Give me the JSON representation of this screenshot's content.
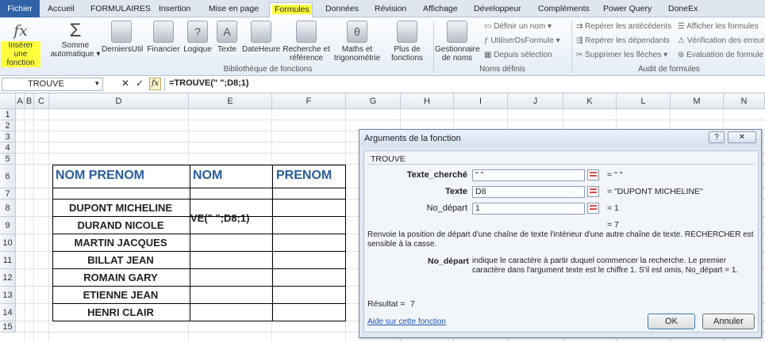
{
  "tabs": [
    "Fichier",
    "Accueil",
    "FORMULAIRES",
    "Insertion",
    "Mise en page",
    "Formules",
    "Données",
    "Révision",
    "Affichage",
    "Développeur",
    "Compléments",
    "Power Query",
    "DoneEx"
  ],
  "ribbon": {
    "insert_fn": "Insérer une fonction",
    "autosum": "Somme automatique",
    "lib_buttons": [
      "DerniersUtil",
      "Financier",
      "Logique",
      "Texte",
      "DateHeure",
      "Recherche et référence",
      "Maths et trigonométrie",
      "Plus de fonctions"
    ],
    "lib_icons": [
      "",
      "",
      "?",
      "A",
      "",
      "",
      "θ",
      ""
    ],
    "lib_group": "Bibliothèque de fonctions",
    "name_mgr": "Gestionnaire de noms",
    "define_name": "Définir un nom",
    "use_in_formula": "UtiliserDsFormule",
    "from_selection": "Depuis sélection",
    "names_group": "Noms définis",
    "trace_prec": "Repérer les antécédents",
    "trace_dep": "Repérer les dépendants",
    "remove_arrows": "Supprimer les flèches",
    "show_formulas": "Afficher les formules",
    "error_check": "Vérification des erreur",
    "eval_formula": "Évaluation de formule",
    "audit_group": "Audit de formules"
  },
  "formula_bar": {
    "name_box": "TROUVE",
    "fx": "fx",
    "formula": "=TROUVE(\" \";D8;1)"
  },
  "columns": [
    "A",
    "B",
    "C",
    "D",
    "E",
    "F",
    "G",
    "H",
    "I",
    "J",
    "K",
    "L",
    "M",
    "N"
  ],
  "rows": [
    "1",
    "2",
    "3",
    "4",
    "5",
    "6",
    "7",
    "8",
    "9",
    "10",
    "11",
    "12",
    "13",
    "14",
    "15"
  ],
  "table": {
    "headers": [
      "NOM PRENOM",
      "NOM",
      "PRENOM"
    ],
    "names": [
      "DUPONT  MICHELINE",
      "DURAND  NICOLE",
      "MARTIN JACQUES",
      "BILLAT JEAN",
      "ROMAIN GARY",
      "ETIENNE JEAN",
      "HENRI  CLAIR"
    ],
    "e8": "VE(\" \";D8;1)"
  },
  "dialog": {
    "title": "Arguments de la fonction",
    "help_btn": "?",
    "close_btn": "✕",
    "fn_name": "TROUVE",
    "args": [
      {
        "label": "Texte_cherché",
        "value": "\" \"",
        "result": "= \" \""
      },
      {
        "label": "Texte",
        "value": "D8",
        "result": "= \"DUPONT  MICHELINE\""
      },
      {
        "label": "No_départ",
        "value": "1",
        "result": "= 1"
      }
    ],
    "total": "= 7",
    "description": "Renvoie la position de départ d'une chaîne de texte l'intérieur d'une autre chaîne de texte. RECHERCHER est sensible à la casse.",
    "param_name": "No_départ",
    "param_desc": "indique le caractère à partir duquel commencer la recherche. Le premier caractère dans l'argument texte est le chiffre 1. S'il est omis, No_départ = 1.",
    "result_label": "Résultat =",
    "result_value": "7",
    "help_link": "Aide sur cette fonction",
    "ok": "OK",
    "cancel": "Annuler"
  }
}
